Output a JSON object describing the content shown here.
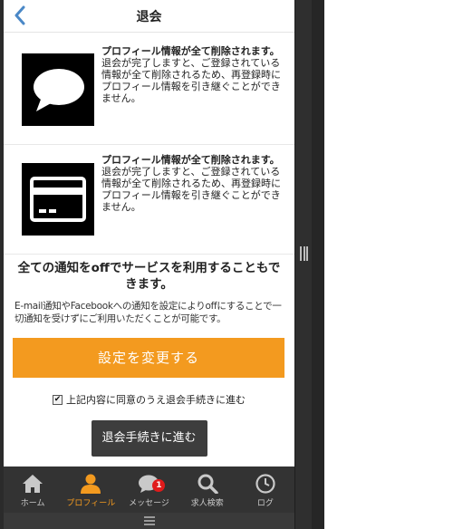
{
  "header": {
    "title": "退会",
    "back_icon": "chevron-left-icon"
  },
  "info_rows": [
    {
      "icon": "speech-bubble-icon",
      "title": "プロフィール情報が全て削除されます。",
      "body": "退会が完了しますと、ご登録されている情報が全て削除されるため、再登録時にプロフィール情報を引き継ぐことができません。"
    },
    {
      "icon": "credit-card-icon",
      "title": "プロフィール情報が全て削除されます。",
      "body": "退会が完了しますと、ご登録されている情報が全て削除されるため、再登録時にプロフィール情報を引き継ぐことができません。"
    }
  ],
  "notify": {
    "heading": "全ての通知をoffでサービスを利用することもできます。",
    "description": "E-mail通知やFacebookへの通知を設定によりoffにすることで一切通知を受けずにご利用いただくことが可能です。"
  },
  "change_button": "設定を変更する",
  "agree": {
    "checked": true,
    "label": "上記内容に同意のうえ退会手続きに進む"
  },
  "proceed_button": "退会手続きに進む",
  "tabs": [
    {
      "label": "ホーム",
      "icon": "home-icon",
      "active": false
    },
    {
      "label": "プロフィール",
      "icon": "person-icon",
      "active": true
    },
    {
      "label": "メッセージ",
      "icon": "message-icon",
      "active": false,
      "badge": "1"
    },
    {
      "label": "求人検索",
      "icon": "search-icon",
      "active": false
    },
    {
      "label": "ログ",
      "icon": "clock-icon",
      "active": false
    }
  ],
  "colors": {
    "accent": "#f39a1f",
    "tabbar": "#333333",
    "badge": "#e01b1b",
    "proceed": "#3d3d3d"
  }
}
